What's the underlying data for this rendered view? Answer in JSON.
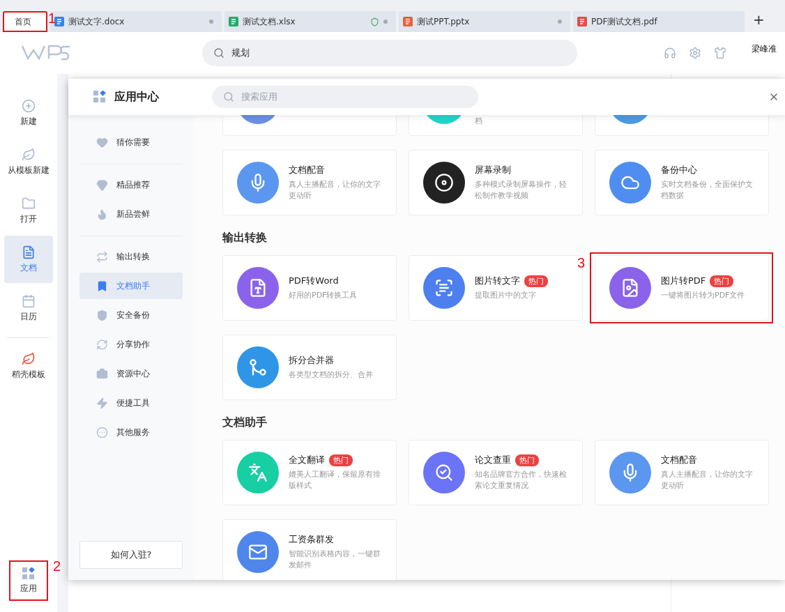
{
  "tabs": [
    {
      "label": "首页",
      "kind": "home",
      "selected": true,
      "highlighted": true,
      "marker": "1"
    },
    {
      "label": "测试文字.docx",
      "kind": "word",
      "selected": false,
      "dot": true,
      "shield": false
    },
    {
      "label": "测试文档.xlsx",
      "kind": "sheet",
      "selected": false,
      "dot": true,
      "shield": true
    },
    {
      "label": "测试PPT.pptx",
      "kind": "ppt",
      "selected": false,
      "dot": true,
      "shield": false
    },
    {
      "label": "PDF测试文档.pdf",
      "kind": "pdf",
      "selected": false,
      "dot": false,
      "shield": false
    }
  ],
  "new_tab": "+",
  "header": {
    "search_value": "规划",
    "user_name": "梁峰准"
  },
  "sidebar": {
    "items": [
      {
        "label": "新建",
        "selected": false
      },
      {
        "label": "从模板新建",
        "selected": false
      },
      {
        "label": "打开",
        "selected": false
      },
      {
        "label": "文档",
        "selected": true
      },
      {
        "label": "日历",
        "selected": false
      },
      {
        "label": "稻壳模板",
        "selected": false
      }
    ],
    "bottom_item": {
      "label": "应用",
      "highlighted": true,
      "marker": "2"
    }
  },
  "app_center": {
    "title": "应用中心",
    "search_placeholder": "搜索应用",
    "nav_groups": [
      [
        {
          "label": "猜你需要",
          "selected": false
        }
      ],
      [
        {
          "label": "精品推荐",
          "selected": false
        },
        {
          "label": "新品尝鲜",
          "selected": false
        }
      ],
      [
        {
          "label": "输出转换",
          "selected": false
        },
        {
          "label": "文档助手",
          "selected": true
        },
        {
          "label": "安全备份",
          "selected": false
        },
        {
          "label": "分享协作",
          "selected": false
        },
        {
          "label": "资源中心",
          "selected": false
        },
        {
          "label": "便捷工具",
          "selected": false
        },
        {
          "label": "其他服务",
          "selected": false
        }
      ]
    ],
    "join_button": "如何入驻?",
    "sections": [
      {
        "cards": [
          {
            "kind": "partial",
            "color": "#6a8fe6"
          },
          {
            "kind": "partial",
            "color": "#23d3c8",
            "desc": "档"
          },
          {
            "kind": "partial",
            "color": "#4a9be3"
          },
          {
            "kind": "full",
            "color": "#5b97ef",
            "name": "文档配音",
            "desc": "真人主播配音，让你的文字更动听"
          },
          {
            "kind": "full",
            "color": "#222222",
            "name": "屏幕录制",
            "desc": "多种模式录制屏幕操作，轻松制作教学视频"
          },
          {
            "kind": "full",
            "color": "#4f8ef0",
            "name": "备份中心",
            "desc": "实时文档备份，全面保护文档数据"
          }
        ]
      },
      {
        "title": "输出转换",
        "cards": [
          {
            "kind": "full",
            "color": "#8a63ea",
            "name": "PDF转Word",
            "desc": "好用的PDF转换工具"
          },
          {
            "kind": "full",
            "color": "#4d7fee",
            "name": "图片转文字",
            "badge": "热门",
            "desc": "提取图片中的文字"
          },
          {
            "kind": "full",
            "color": "#8a63ea",
            "name": "图片转PDF",
            "badge": "热门",
            "desc": "一键将图片转为PDF文件",
            "highlighted": true,
            "marker": "3"
          },
          {
            "kind": "full",
            "color": "#2f95e6",
            "name": "拆分合并器",
            "desc": "各类型文档的拆分、合并"
          }
        ]
      },
      {
        "title": "文档助手",
        "cards": [
          {
            "kind": "full",
            "color": "#17cfa3",
            "name": "全文翻译",
            "badge": "热门",
            "desc": "媲美人工翻译，保留原有排版样式"
          },
          {
            "kind": "full",
            "color": "#6b74f7",
            "name": "论文查重",
            "badge": "热门",
            "desc": "知名品牌官方合作，快速检索论文重复情况"
          },
          {
            "kind": "full",
            "color": "#5b97ef",
            "name": "文档配音",
            "desc": "真人主播配音，让你的文字更动听"
          },
          {
            "kind": "full",
            "color": "#4f86ec",
            "name": "工资条群发",
            "desc": "智能识别表格内容，一键群发邮件"
          }
        ]
      }
    ]
  }
}
